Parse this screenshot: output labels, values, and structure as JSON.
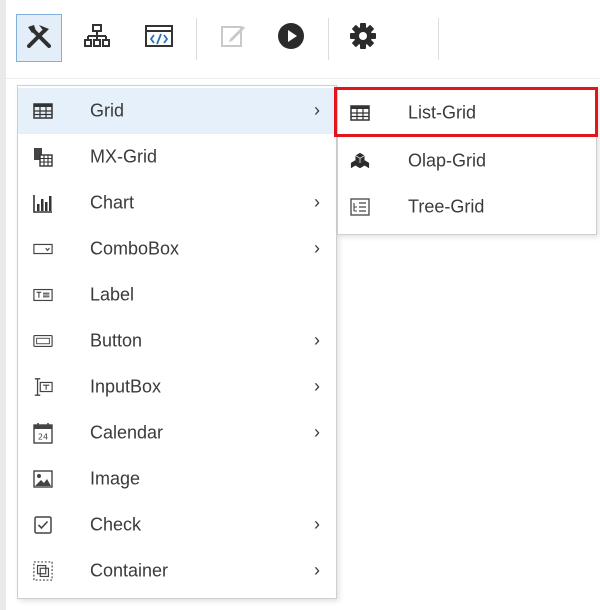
{
  "toolbar": {
    "buttons": [
      {
        "icon": "tools-icon",
        "state": "active"
      },
      {
        "icon": "hierarchy-icon",
        "state": "normal"
      },
      {
        "icon": "code-icon",
        "state": "normal"
      },
      {
        "icon": "edit-icon",
        "state": "disabled"
      },
      {
        "icon": "play-icon",
        "state": "normal"
      },
      {
        "icon": "gear-icon",
        "state": "normal"
      }
    ]
  },
  "menu": {
    "items": [
      {
        "label": "Grid",
        "icon": "grid-icon",
        "submenu": true,
        "chevron": "›"
      },
      {
        "label": "MX-Grid",
        "icon": "mx-grid-icon",
        "submenu": false
      },
      {
        "label": "Chart",
        "icon": "bar-chart-icon",
        "submenu": true,
        "chevron": "›"
      },
      {
        "label": "ComboBox",
        "icon": "combobox-icon",
        "submenu": true,
        "chevron": "›"
      },
      {
        "label": "Label",
        "icon": "label-icon",
        "submenu": false
      },
      {
        "label": "Button",
        "icon": "button-icon",
        "submenu": true,
        "chevron": "›"
      },
      {
        "label": "InputBox",
        "icon": "inputbox-icon",
        "submenu": true,
        "chevron": "›"
      },
      {
        "label": "Calendar",
        "icon": "calendar-icon",
        "submenu": true,
        "chevron": "›"
      },
      {
        "label": "Image",
        "icon": "image-icon",
        "submenu": false
      },
      {
        "label": "Check",
        "icon": "checkbox-icon",
        "submenu": true,
        "chevron": "›"
      },
      {
        "label": "Container",
        "icon": "container-icon",
        "submenu": true,
        "chevron": "›"
      }
    ]
  },
  "submenu": {
    "items": [
      {
        "label": "List-Grid",
        "icon": "list-grid-icon",
        "highlighted": true
      },
      {
        "label": "Olap-Grid",
        "icon": "olap-grid-icon",
        "highlighted": false
      },
      {
        "label": "Tree-Grid",
        "icon": "tree-grid-icon",
        "highlighted": false
      }
    ]
  },
  "colors": {
    "highlight_border": "#e0161a",
    "active_tool_bg": "#e3eef9",
    "icon_dark": "#2e2e2e",
    "icon_blue": "#2f6fb5"
  }
}
